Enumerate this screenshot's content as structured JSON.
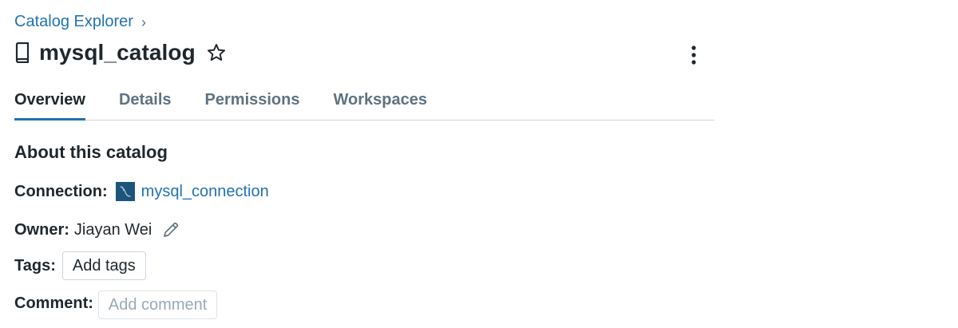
{
  "breadcrumb": {
    "root_label": "Catalog Explorer"
  },
  "header": {
    "title": "mysql_catalog"
  },
  "tabs": [
    {
      "label": "Overview",
      "active": true
    },
    {
      "label": "Details",
      "active": false
    },
    {
      "label": "Permissions",
      "active": false
    },
    {
      "label": "Workspaces",
      "active": false
    }
  ],
  "about": {
    "heading": "About this catalog",
    "connection_label": "Connection:",
    "connection_value": "mysql_connection",
    "owner_label": "Owner:",
    "owner_value": "Jiayan Wei",
    "tags_label": "Tags:",
    "tags_button": "Add tags",
    "comment_label": "Comment:",
    "comment_button": "Add comment"
  },
  "icons": {
    "catalog": "book-icon",
    "favorite": "star-outline-icon",
    "menu": "kebab-menu-icon",
    "connection": "mysql-icon",
    "edit": "pencil-icon",
    "breadcrumb_separator": "chevron-right-icon"
  },
  "colors": {
    "link": "#2272b4",
    "text": "#1f272d",
    "muted": "#5f7281",
    "active_tab_underline": "#2272b4",
    "mysql_icon_bg": "#1d5479"
  }
}
